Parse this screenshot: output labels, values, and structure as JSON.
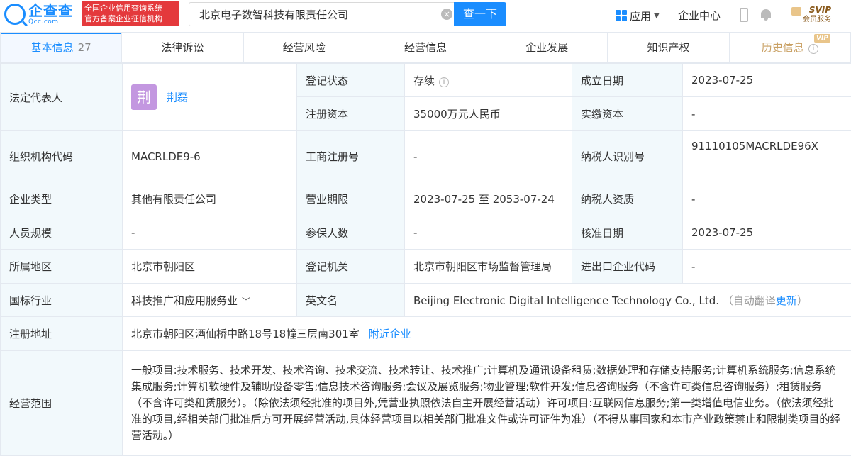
{
  "header": {
    "logo_cn": "企查查",
    "logo_en": "Qcc.com",
    "slogan_line1": "全国企业信用查询系统",
    "slogan_line2": "官方备案企业征信机构",
    "search_value": "北京电子数智科技有限责任公司",
    "search_button": "查一下",
    "nav_app": "应用",
    "nav_center": "企业中心",
    "vip_main": "SVIP",
    "vip_sub": "会员服务"
  },
  "tabs": [
    {
      "label": "基本信息",
      "count": "27",
      "active": true
    },
    {
      "label": "法律诉讼"
    },
    {
      "label": "经营风险"
    },
    {
      "label": "经营信息"
    },
    {
      "label": "企业发展"
    },
    {
      "label": "知识产权"
    },
    {
      "label": "历史信息",
      "badge": "VIP"
    }
  ],
  "info": {
    "legal_rep_label": "法定代表人",
    "legal_rep_avatar": "荆",
    "legal_rep_name": "荆磊",
    "reg_status_label": "登记状态",
    "reg_status_value": "存续",
    "found_date_label": "成立日期",
    "found_date_value": "2023-07-25",
    "reg_capital_label": "注册资本",
    "reg_capital_value": "35000万元人民币",
    "paid_capital_label": "实缴资本",
    "paid_capital_value": "-",
    "org_code_label": "组织机构代码",
    "org_code_value": "MACRLDE9-6",
    "biz_reg_no_label": "工商注册号",
    "biz_reg_no_value": "-",
    "tax_id_label": "纳税人识别号",
    "tax_id_value": "91110105MACRLDE96X",
    "company_type_label": "企业类型",
    "company_type_value": "其他有限责任公司",
    "biz_term_label": "营业期限",
    "biz_term_value": "2023-07-25 至 2053-07-24",
    "taxpayer_qual_label": "纳税人资质",
    "taxpayer_qual_value": "-",
    "staff_size_label": "人员规模",
    "staff_size_value": "-",
    "insured_label": "参保人数",
    "insured_value": "-",
    "approval_date_label": "核准日期",
    "approval_date_value": "2023-07-25",
    "region_label": "所属地区",
    "region_value": "北京市朝阳区",
    "reg_authority_label": "登记机关",
    "reg_authority_value": "北京市朝阳区市场监督管理局",
    "import_export_label": "进出口企业代码",
    "import_export_value": "-",
    "industry_label": "国标行业",
    "industry_value": "科技推广和应用服务业",
    "english_name_label": "英文名",
    "english_name_value": "Beijing Electronic Digital Intelligence Technology Co., Ltd.",
    "auto_translate": "（自动翻译",
    "update_link": "更新",
    "auto_translate_end": "）",
    "address_label": "注册地址",
    "address_value": "北京市朝阳区酒仙桥中路18号18幢三层南301室",
    "nearby_link": "附近企业",
    "scope_label": "经营范围",
    "scope_value": "一般项目:技术服务、技术开发、技术咨询、技术交流、技术转让、技术推广;计算机及通讯设备租赁;数据处理和存储支持服务;计算机系统服务;信息系统集成服务;计算机软硬件及辅助设备零售;信息技术咨询服务;会议及展览服务;物业管理;软件开发;信息咨询服务（不含许可类信息咨询服务）;租赁服务（不含许可类租赁服务）。（除依法须经批准的项目外,凭营业执照依法自主开展经营活动）许可项目:互联网信息服务;第一类增值电信业务。（依法须经批准的项目,经相关部门批准后方可开展经营活动,具体经营项目以相关部门批准文件或许可证件为准）（不得从事国家和本市产业政策禁止和限制类项目的经营活动。）"
  }
}
